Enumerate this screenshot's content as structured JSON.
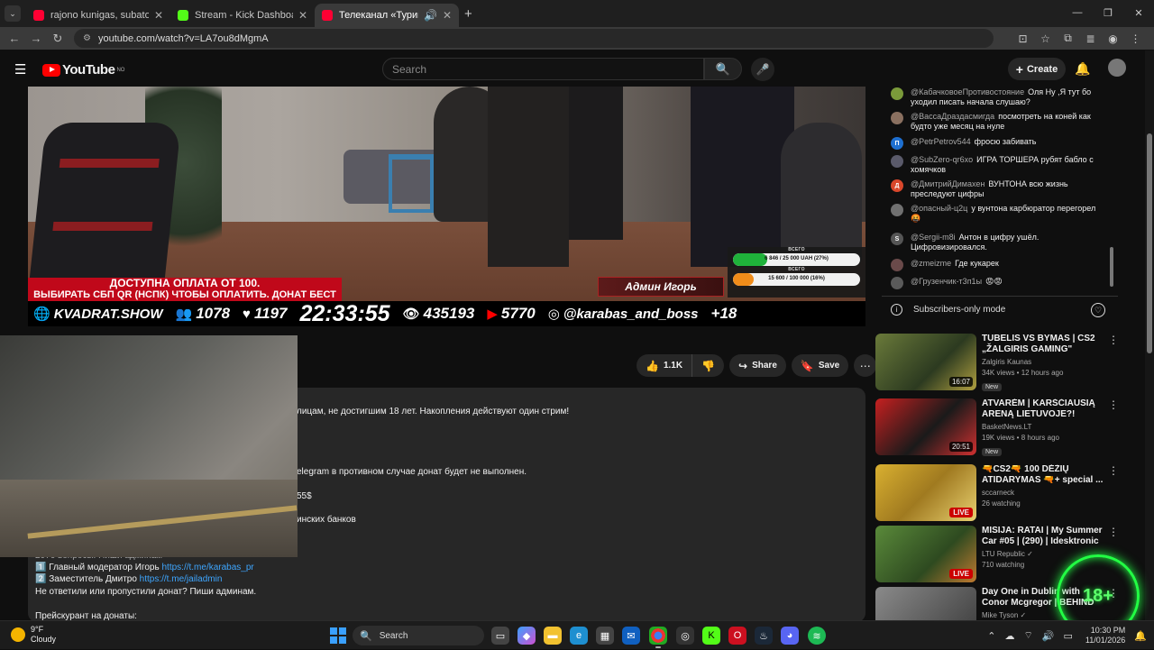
{
  "browser": {
    "tabs": [
      {
        "label": "rajono kunigas, subatono mom",
        "active": false,
        "favicon_color": "#ff0033"
      },
      {
        "label": "Stream - Kick Dashboard",
        "active": false,
        "favicon_color": "#53fc18"
      },
      {
        "label": "Телеканал «Турик и Конюх»",
        "active": true,
        "favicon_color": "#ff0033"
      }
    ],
    "url": "youtube.com/watch?v=LA7ou8dMgmA"
  },
  "youtube": {
    "logo_text": "YouTube",
    "region": "NO",
    "search_placeholder": "Search",
    "create_label": "Create"
  },
  "overlay": {
    "banner_line1": "ДОСТУПНА ОПЛАТА ОТ 100.",
    "banner_line2": "ВЫБИРАТЬ СБП QR (НСПК) ЧТОБЫ ОПЛАТИТЬ. ДОНАТ БЕСТ",
    "nameplate": "Админ Игорь",
    "goals": [
      {
        "label": "ВСЕГО",
        "text": "6 846 / 25 000 UAH (27%)",
        "percent": 27,
        "color": "#1fb23a"
      },
      {
        "label": "ВСЕГО",
        "text": "15 600 / 100 000 (16%)",
        "percent": 16,
        "color": "#f08c1a"
      }
    ],
    "brand": "KVADRAT.SHOW",
    "viewers_count": "1078",
    "likes_count": "1197",
    "time": "22:33:55",
    "views_count": "435193",
    "yt_count": "5770",
    "instagram_handle": "@karabas_and_boss",
    "age_rating": "+18"
  },
  "actions": {
    "like_count": "1.1K",
    "share_label": "Share",
    "save_label": "Save"
  },
  "description": {
    "line1": "лицам, не достигшим 18 лет. Накопления действуют один стрим!",
    "line2": "elegram в противном случае донат будет не выполнен.",
    "line3": "55$",
    "line4": "инских банков",
    "partial_line": "2076 вопросы. Пиши админам",
    "mod1_prefix": "1️⃣ Главный модератор Игорь ",
    "mod1_link": "https://t.me/karabas_pr",
    "mod2_prefix": "2️⃣ Заместитель Дмитро ",
    "mod2_link": "https://t.me/jailadmin",
    "line_missed": "Не ответили или пропустили донат? Пиши админам.",
    "line_price": "Прейскурант на донаты:"
  },
  "chat": {
    "messages": [
      {
        "author": "@КабачковоеПротивостояние",
        "text": "Оля Ну ,Я тут бо уходил писать начала слушаю?",
        "avatar_color": "#7a9a3a",
        "avatar_letter": ""
      },
      {
        "author": "@ВассаДраздасмигда",
        "text": "посмотреть на коней как будто уже месяц на нуле",
        "avatar_color": "#8a7060",
        "avatar_letter": ""
      },
      {
        "author": "@PetrPetrov544",
        "text": "фросю забивать",
        "avatar_color": "#1e6fd0",
        "avatar_letter": "П"
      },
      {
        "author": "@SubZero-qr6xo",
        "text": "ИГРА ТОРШЕРА рубят бабло с хомячков",
        "avatar_color": "#5a5a6a",
        "avatar_letter": ""
      },
      {
        "author": "@ДмитрийДимахен",
        "text": "ВУНТОНА всю жизнь преследуют цифры",
        "avatar_color": "#d9472b",
        "avatar_letter": "Д"
      },
      {
        "author": "@опасный-ц2ц",
        "text": "у вунтона карбюратор перегорел 🤬",
        "avatar_color": "#707070",
        "avatar_letter": ""
      },
      {
        "author": "@Sergii-m8i",
        "text": "Антон в цифру ушёл. Цифровизировался.",
        "avatar_color": "#555555",
        "avatar_letter": "S"
      },
      {
        "author": "@zmeizme",
        "text": "Где кукарек",
        "avatar_color": "#6a4a4a",
        "avatar_letter": ""
      },
      {
        "author": "@Грузенчик-т3п1ы",
        "text": "😡😡",
        "avatar_color": "#5a5a5a",
        "avatar_letter": ""
      }
    ],
    "subs_mode_label": "Subscribers-only mode"
  },
  "recommendations": [
    {
      "title": "TUBELIS VS BYMAS | CS2 „ŽALGIRIS GAMING\"",
      "channel": "Zalgiris Kaunas",
      "meta": "34K views • 12 hours ago",
      "badge": "New",
      "duration": "16:07",
      "live": false
    },
    {
      "title": "ATVARĖM | KARŠČIAUSIĄ ARENĄ LIETUVOJE?!",
      "channel": "BasketNews.LT",
      "meta": "19K views • 8 hours ago",
      "badge": "New",
      "duration": "20:51",
      "live": false
    },
    {
      "title": "🔫CS2🔫 100 DĖŽIŲ ATIDARYMAS 🔫+ special ...",
      "channel": "sccarneck",
      "meta": "26 watching",
      "badge": "",
      "duration": "LIVE",
      "live": true
    },
    {
      "title": "MISIJA: RATAI | My Summer Car #05 | (290) | Idesktronic ...",
      "channel": "LTU Republic ✓",
      "meta": "710 watching",
      "badge": "",
      "duration": "LIVE",
      "live": true
    },
    {
      "title": "Day One in Dublin with Conor Mcgregor | BEHIND THE MIKE ...",
      "channel": "Mike Tyson ✓",
      "meta": "",
      "badge": "",
      "duration": "",
      "live": false
    }
  ],
  "neon_badge": "18+",
  "taskbar": {
    "weather_temp": "9°F",
    "weather_desc": "Cloudy",
    "search_label": "Search",
    "time": "10:30 PM",
    "date": "11/01/2026"
  }
}
